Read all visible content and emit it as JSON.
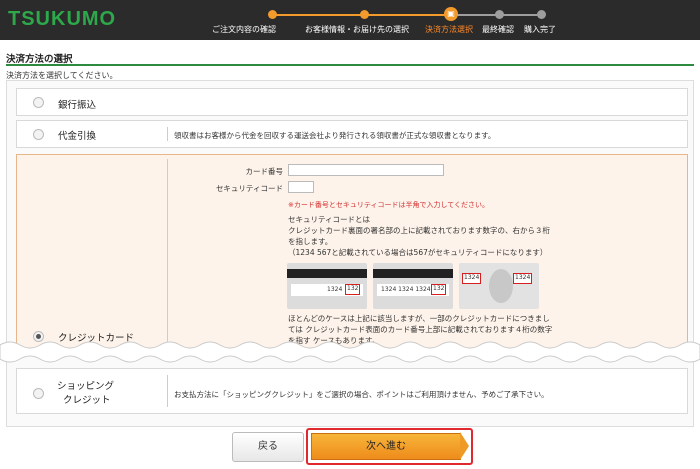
{
  "header": {
    "logo": "TSUKUMO",
    "steps": [
      {
        "label": "ご注文内容の確認",
        "state": "done"
      },
      {
        "label": "お客様情報・お届け先の選択",
        "state": "done"
      },
      {
        "label": "決済方法選択",
        "state": "current"
      },
      {
        "label": "最終確認",
        "state": "todo"
      },
      {
        "label": "購入完了",
        "state": "todo"
      }
    ],
    "colors": {
      "done": "#f39a2d",
      "todo": "#9e9e9e",
      "bar": "#2b2b2b",
      "logo": "#2da84a"
    }
  },
  "section": {
    "title": "決済方法の選択",
    "instruction": "決済方法を選択してください。"
  },
  "options": {
    "bank": {
      "label": "銀行振込"
    },
    "cod": {
      "label": "代金引換",
      "note": "領収書はお客様から代金を回収する運送会社より発行される領収書が正式な領収書となります。"
    },
    "credit": {
      "label": "クレジットカード",
      "card_number_label": "カード番号",
      "card_number_value": "",
      "security_label": "セキュリティコード",
      "security_value": "",
      "warning": "※カード番号とセキュリティコードは半角で入力してください。",
      "explain_lines": [
        "セキュリティコードとは",
        "クレジットカード裏面の署名部の上に記載されております数字の、右から３桁",
        "を指します。",
        "（1234 567と記載されている場合は567がセキュリティコードになります）"
      ],
      "cards": {
        "num_a": "1324",
        "code_a": "132",
        "num_b": "1324  1324  1324",
        "code_b": "132",
        "front_left": "1324",
        "front_right": "1324"
      },
      "note_lines": [
        "ほとんどのケースは上記に該当しますが、一部のクレジットカードにつきまし",
        "ては クレジットカード表面のカード番号上部に記載されております４桁の数字",
        "を指す ケースもあります。"
      ]
    },
    "shopping": {
      "label_line1": "ショッピング",
      "label_line2": "クレジット",
      "note": "お支払方法に「ショッピングクレジット」をご選択の場合、ポイントはご利用頂けません、予めご了承下さい。"
    }
  },
  "buttons": {
    "back": "戻る",
    "next": "次へ進む"
  }
}
